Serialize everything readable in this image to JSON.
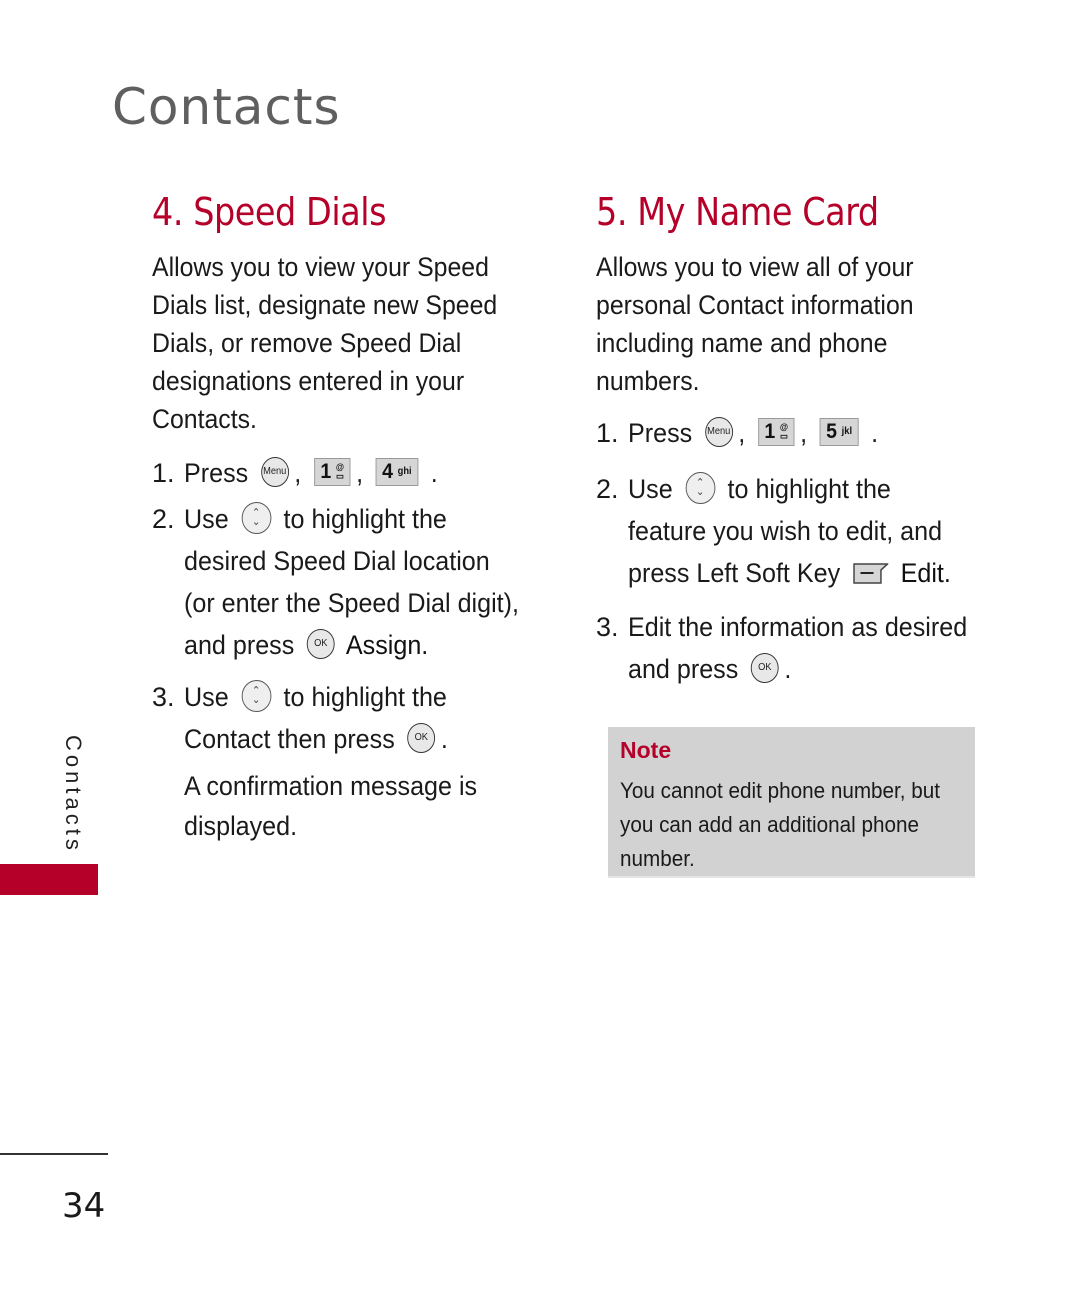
{
  "header": {
    "title": "Contacts"
  },
  "speed_dials": {
    "title": "4. Speed Dials",
    "description": [
      "Allows you to view your Speed",
      "Dials list, designate new Speed",
      "Dials, or remove Speed Dial",
      "designations entered in your",
      "Contacts."
    ],
    "step1": {
      "num": "1.",
      "text": "Press",
      "menu_key": "Menu",
      "key1_digit": "1",
      "key1_sub_top": "@",
      "key1_sub_bottom": "▭",
      "key2_digit": "4",
      "key2_letters": "ghi"
    },
    "step2": {
      "num": "2.",
      "use": "Use",
      "lines": [
        "to highlight the",
        "desired Speed Dial location",
        "(or enter the Speed Dial digit),",
        "and press"
      ],
      "ok_key": "OK",
      "action": "Assign."
    },
    "step3": {
      "num": "3.",
      "use": "Use",
      "lines": [
        "to highlight the",
        "Contact then press"
      ],
      "ok_key": "OK",
      "confirmation": [
        "A confirmation message is",
        "displayed."
      ]
    }
  },
  "my_name_card": {
    "title": "5. My Name Card",
    "description": [
      "Allows you to view all of your",
      "personal Contact information",
      "including name and phone",
      "numbers."
    ],
    "step1": {
      "num": "1.",
      "text": "Press",
      "menu_key": "Menu",
      "key1_digit": "1",
      "key1_sub_top": "@",
      "key1_sub_bottom": "▭",
      "key2_digit": "5",
      "key2_letters": "jkl"
    },
    "step2": {
      "num": "2.",
      "use": "Use",
      "lines": [
        "to highlight the",
        "feature you wish to edit, and",
        "press Left Soft Key"
      ],
      "action": "Edit."
    },
    "step3": {
      "num": "3.",
      "lines": [
        "Edit the information as desired",
        "and press"
      ],
      "ok_key": "OK"
    }
  },
  "note": {
    "title": "Note",
    "lines": [
      "You cannot edit phone number, but",
      "you can add an additional phone",
      "number."
    ]
  },
  "side_tab": {
    "label": "Contacts",
    "accent_color": "#b5002a"
  },
  "footer": {
    "page_number": "34"
  },
  "symbols": {
    "comma": ",",
    "period": ".",
    "nav_up": "⌃",
    "nav_down": "⌄"
  }
}
